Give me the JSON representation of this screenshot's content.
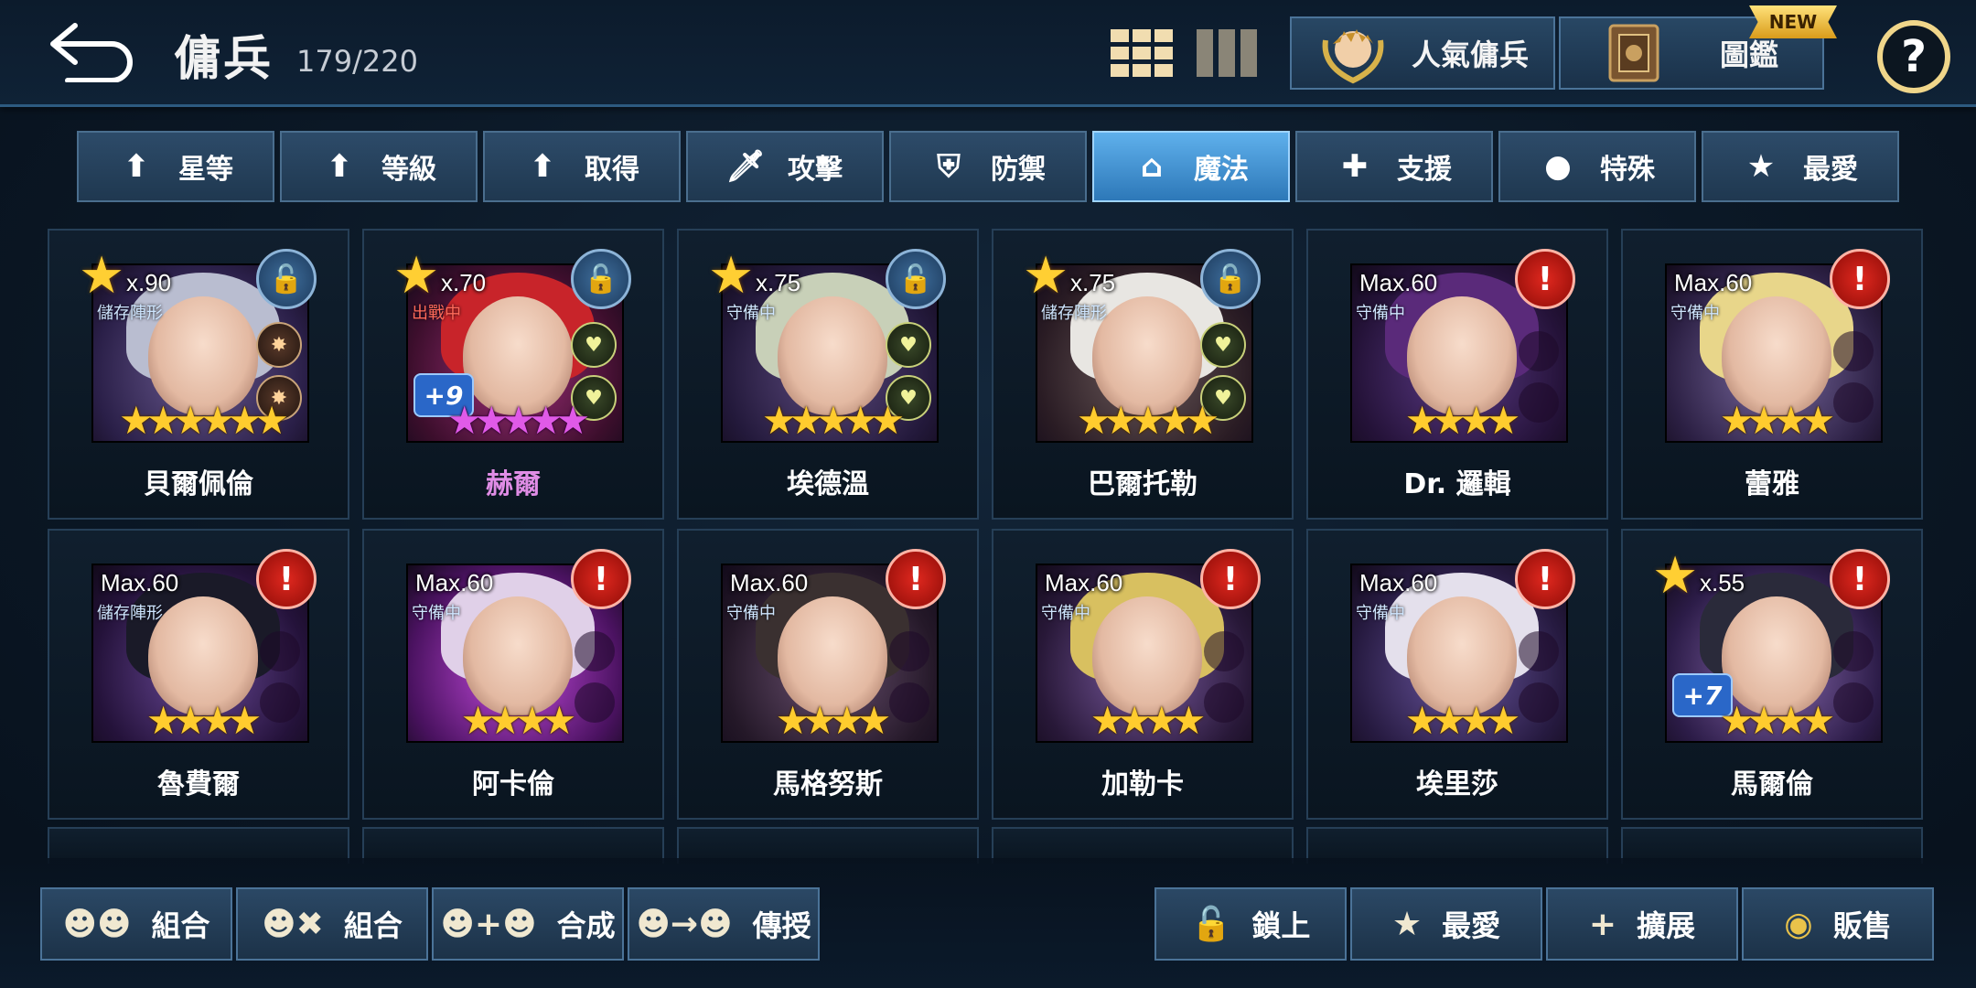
{
  "header": {
    "title": "傭兵",
    "count": "179/220",
    "popular_label": "人氣傭兵",
    "codex_label": "圖鑑",
    "new_badge": "NEW",
    "help_label": "?"
  },
  "filters": [
    {
      "label": "星等",
      "icon": "arrow-up-icon",
      "active": false
    },
    {
      "label": "等級",
      "icon": "arrow-up-icon",
      "active": false
    },
    {
      "label": "取得",
      "icon": "arrow-up-icon",
      "active": false
    },
    {
      "label": "攻擊",
      "icon": "sword-icon",
      "active": false
    },
    {
      "label": "防禦",
      "icon": "shield-icon",
      "active": false
    },
    {
      "label": "魔法",
      "icon": "wizard-hat-icon",
      "active": true
    },
    {
      "label": "支援",
      "icon": "support-icon",
      "active": false
    },
    {
      "label": "特殊",
      "icon": "slime-icon",
      "active": false
    },
    {
      "label": "最愛",
      "icon": "star-icon",
      "active": false
    }
  ],
  "heroes": [
    {
      "name": "貝爾佩倫",
      "level_text": "x.90",
      "status": "儲存陣形",
      "stars": 6,
      "star_color": "gold",
      "locked": true,
      "favorite": true,
      "plus": "",
      "rune_color": "orange"
    },
    {
      "name": "赫爾",
      "level_text": "x.70",
      "status": "出戰中",
      "stars": 5,
      "star_color": "pink",
      "locked": true,
      "favorite": true,
      "plus": "+9",
      "rune_color": "green"
    },
    {
      "name": "埃德溫",
      "level_text": "x.75",
      "status": "守備中",
      "stars": 5,
      "star_color": "gold",
      "locked": true,
      "favorite": true,
      "plus": "",
      "rune_color": "green"
    },
    {
      "name": "巴爾托勒",
      "level_text": "x.75",
      "status": "儲存陣形",
      "stars": 5,
      "star_color": "gold",
      "locked": true,
      "favorite": true,
      "plus": "",
      "rune_color": "green"
    },
    {
      "name": "Dr. 邏輯",
      "level_text": "Max.60",
      "status": "守備中",
      "stars": 4,
      "star_color": "gold",
      "locked": false,
      "favorite": false,
      "plus": "",
      "rune_color": ""
    },
    {
      "name": "蕾雅",
      "level_text": "Max.60",
      "status": "守備中",
      "stars": 4,
      "star_color": "gold",
      "locked": false,
      "favorite": false,
      "plus": "",
      "rune_color": ""
    },
    {
      "name": "魯費爾",
      "level_text": "Max.60",
      "status": "儲存陣形",
      "stars": 4,
      "star_color": "gold",
      "locked": false,
      "favorite": false,
      "plus": "",
      "rune_color": ""
    },
    {
      "name": "阿卡倫",
      "level_text": "Max.60",
      "status": "守備中",
      "stars": 4,
      "star_color": "gold",
      "locked": false,
      "favorite": false,
      "plus": "",
      "rune_color": ""
    },
    {
      "name": "馬格努斯",
      "level_text": "Max.60",
      "status": "守備中",
      "stars": 4,
      "star_color": "gold",
      "locked": false,
      "favorite": false,
      "plus": "",
      "rune_color": ""
    },
    {
      "name": "加勒卡",
      "level_text": "Max.60",
      "status": "守備中",
      "stars": 4,
      "star_color": "gold",
      "locked": false,
      "favorite": false,
      "plus": "",
      "rune_color": ""
    },
    {
      "name": "埃里莎",
      "level_text": "Max.60",
      "status": "守備中",
      "stars": 4,
      "star_color": "gold",
      "locked": false,
      "favorite": false,
      "plus": "",
      "rune_color": ""
    },
    {
      "name": "馬爾倫",
      "level_text": "x.55",
      "status": "",
      "stars": 4,
      "star_color": "gold",
      "locked": false,
      "favorite": true,
      "plus": "+7",
      "rune_color": ""
    }
  ],
  "portrait_colors": [
    {
      "c1": "#6a5a90",
      "c2": "#2a1f48",
      "hair": "#b9bdd0"
    },
    {
      "c1": "#a0307a",
      "c2": "#3c0e2c",
      "hair": "#c8242a"
    },
    {
      "c1": "#5c4a7e",
      "c2": "#23193b",
      "hair": "#c8d0b8"
    },
    {
      "c1": "#6b5a5a",
      "c2": "#2a1c24",
      "hair": "#e8e6e2"
    },
    {
      "c1": "#5b3a86",
      "c2": "#241238",
      "hair": "#5a2a7a"
    },
    {
      "c1": "#7a6aa0",
      "c2": "#2c2044",
      "hair": "#e8d68a"
    },
    {
      "c1": "#6b4a9a",
      "c2": "#24123a",
      "hair": "#1a1a28"
    },
    {
      "c1": "#c64ae0",
      "c2": "#4a1260",
      "hair": "#e0d0e8"
    },
    {
      "c1": "#6a5070",
      "c2": "#241828",
      "hair": "#3a3030"
    },
    {
      "c1": "#7a5aa0",
      "c2": "#281838",
      "hair": "#d8c060"
    },
    {
      "c1": "#6a56a0",
      "c2": "#261a40",
      "hair": "#e4e0ec"
    },
    {
      "c1": "#8a6ab0",
      "c2": "#2c1c48",
      "hair": "#2a2a3a"
    }
  ],
  "bottom_buttons": [
    {
      "label": "組合",
      "icon": "team-icon"
    },
    {
      "label": "組合",
      "icon": "combine-icon"
    },
    {
      "label": "合成",
      "icon": "fuse-icon"
    },
    {
      "label": "傳授",
      "icon": "transfer-icon"
    },
    {
      "label": "鎖上",
      "icon": "lock-icon"
    },
    {
      "label": "最愛",
      "icon": "star-icon"
    },
    {
      "label": "擴展",
      "icon": "plus-icon"
    },
    {
      "label": "販售",
      "icon": "gold-coin-icon"
    }
  ]
}
